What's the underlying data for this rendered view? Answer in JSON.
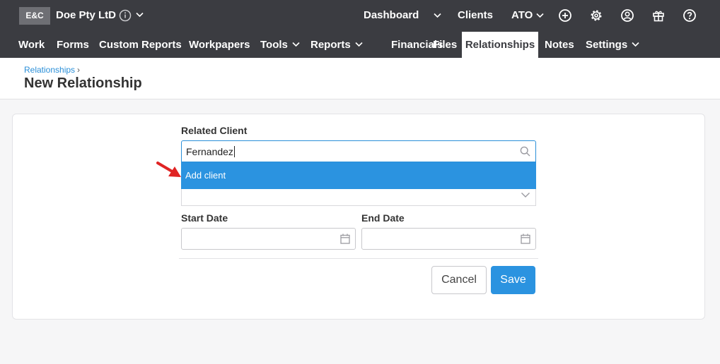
{
  "topbar": {
    "logo": "E&C",
    "company": "Doe Pty LtD",
    "links": {
      "dashboard": "Dashboard",
      "clients": "Clients",
      "ato": "ATO"
    },
    "icons": [
      "add-circle-icon",
      "gear-icon",
      "user-circle-icon",
      "gift-icon",
      "help-circle-icon"
    ]
  },
  "nav": {
    "items": [
      {
        "label": "Work"
      },
      {
        "label": "Forms"
      },
      {
        "label": "Custom Reports"
      },
      {
        "label": "Workpapers"
      },
      {
        "label": "Tools"
      },
      {
        "label": "Reports"
      },
      {
        "label": "Financials"
      },
      {
        "label": "Files"
      },
      {
        "label": "Relationships",
        "active": true
      },
      {
        "label": "Notes"
      },
      {
        "label": "Settings"
      }
    ]
  },
  "header": {
    "breadcrumb": "Relationships",
    "breadcrumb_sep": "›",
    "title": "New Relationship"
  },
  "form": {
    "related_client_label": "Related Client",
    "related_client_value": "Fernandez",
    "dropdown_option": "Add client",
    "start_date_label": "Start Date",
    "end_date_label": "End Date",
    "start_date_value": "",
    "end_date_value": ""
  },
  "buttons": {
    "cancel": "Cancel",
    "save": "Save"
  },
  "colors": {
    "topbar": "#3b3c41",
    "accent": "#2b93e0",
    "arrow": "#e02424"
  }
}
